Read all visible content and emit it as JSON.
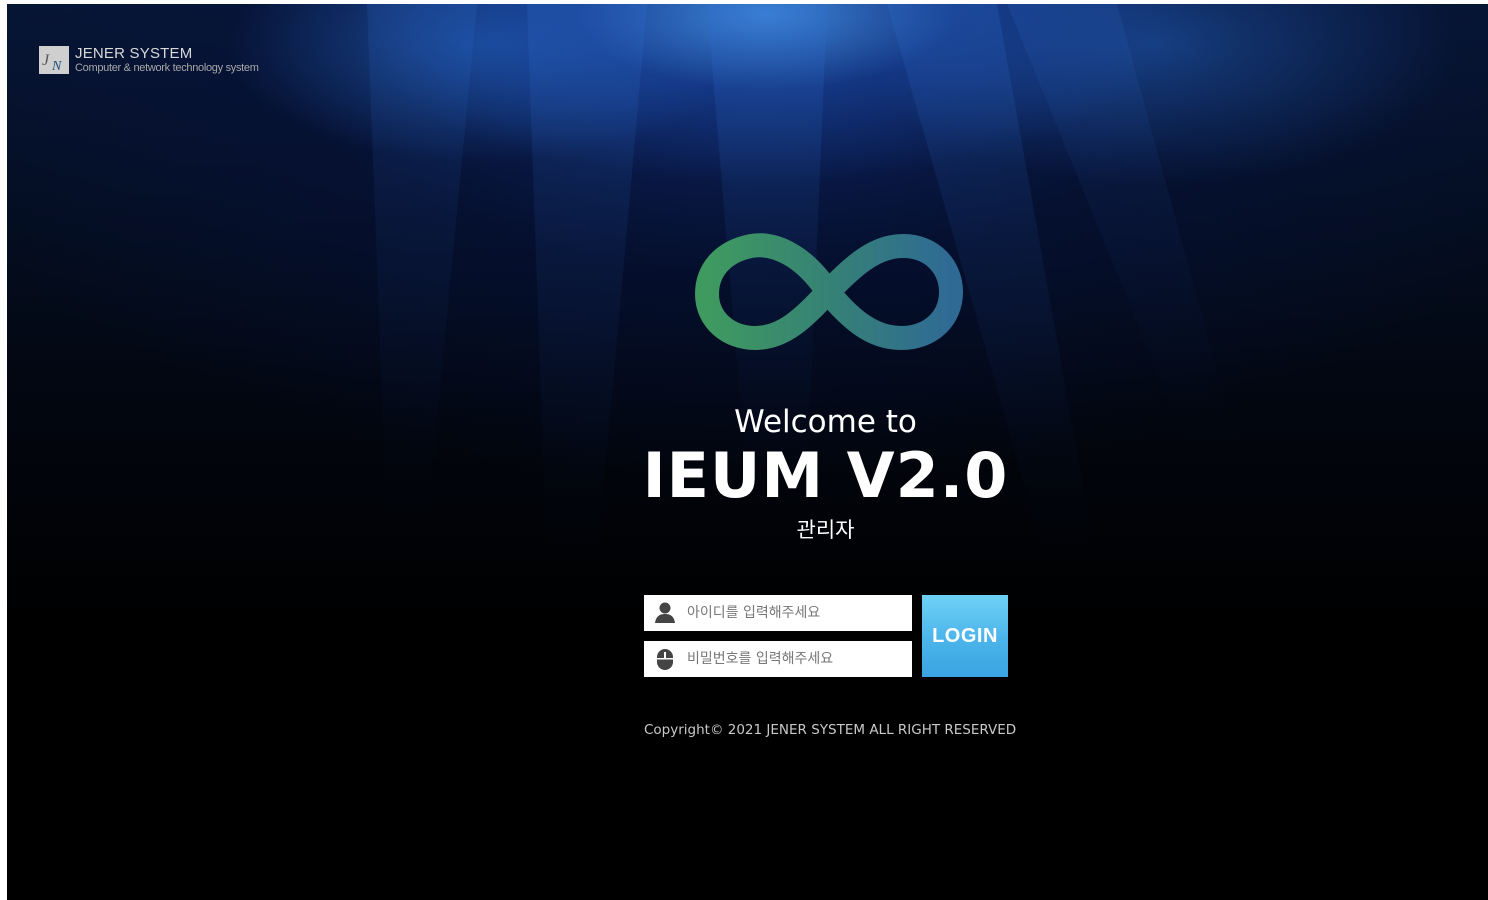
{
  "brand": {
    "logo_icon": "jener-system-logo",
    "name": "JENER SYSTEM",
    "tagline": "Computer & network technology system"
  },
  "hero": {
    "logo_icon": "infinity-icon",
    "welcome": "Welcome to",
    "product": "IEUM V2.0",
    "role": "관리자"
  },
  "login": {
    "id_placeholder": "아이디를 입력해주세요",
    "id_value": "",
    "password_placeholder": "비밀번호를 입력해주세요",
    "password_value": "",
    "button_label": "LOGIN",
    "id_icon": "user-icon",
    "password_icon": "lock-icon"
  },
  "footer": {
    "copyright": "Copyright© 2021 JENER SYSTEM ALL RIGHT RESERVED"
  },
  "colors": {
    "login_button": "#4ab4ea",
    "infinity_green": "#3f9a5f",
    "infinity_blue": "#2e6b8f",
    "background": "#000000"
  }
}
